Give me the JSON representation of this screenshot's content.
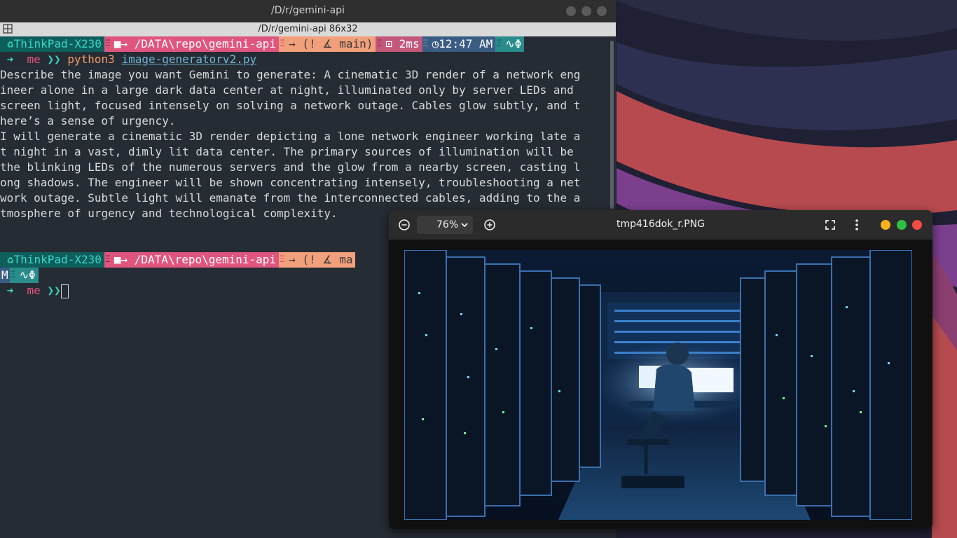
{
  "terminal": {
    "window_title": "/D/r/gemini-api",
    "tab_title": "/D/r/gemini-api 86x32",
    "prompt1": {
      "host": "ThinkPad-X230",
      "path": "/DATA\\repo\\gemini-api",
      "git": "(ǃ ∡ main)",
      "duration": "2ms",
      "time": "12:47 AM",
      "status": "Φ"
    },
    "prompt2": {
      "host": "ThinkPad-X230",
      "path": "/DATA\\repo\\gemini-api",
      "git": "(ǃ ∡ ma",
      "wrap_char": "M",
      "status": "Φ"
    },
    "user": "me",
    "command": "python3",
    "command_arg": "image-generatorv2.py",
    "output_lines": [
      "Describe the image you want Gemini to generate: A cinematic 3D render of a network eng",
      "ineer alone in a large dark data center at night, illuminated only by server LEDs and",
      "screen light, focused intensely on solving a network outage. Cables glow subtly, and t",
      "here’s a sense of urgency.",
      "I will generate a cinematic 3D render depicting a lone network engineer working late a",
      "t night in a vast, dimly lit data center. The primary sources of illumination will be",
      "the blinking LEDs of the numerous servers and the glow from a nearby screen, casting l",
      "ong shadows. The engineer will be shown concentrating intensely, troubleshooting a net",
      "work outage. Subtle light will emanate from the interconnected cables, adding to the a",
      "tmosphere of urgency and technological complexity."
    ]
  },
  "viewer": {
    "title": "tmp416dok_r.PNG",
    "zoom": "76%",
    "image_description_icon": "image-content"
  },
  "colors": {
    "host_bg": "#0e5e5c",
    "path_bg": "#e0557e",
    "git_bg": "#f2a07c",
    "time_bg": "#3a5c84",
    "terminal_bg": "#262c33",
    "traffic_min": "#f5b21c",
    "traffic_max": "#2fbf43",
    "traffic_close": "#f04b45"
  }
}
